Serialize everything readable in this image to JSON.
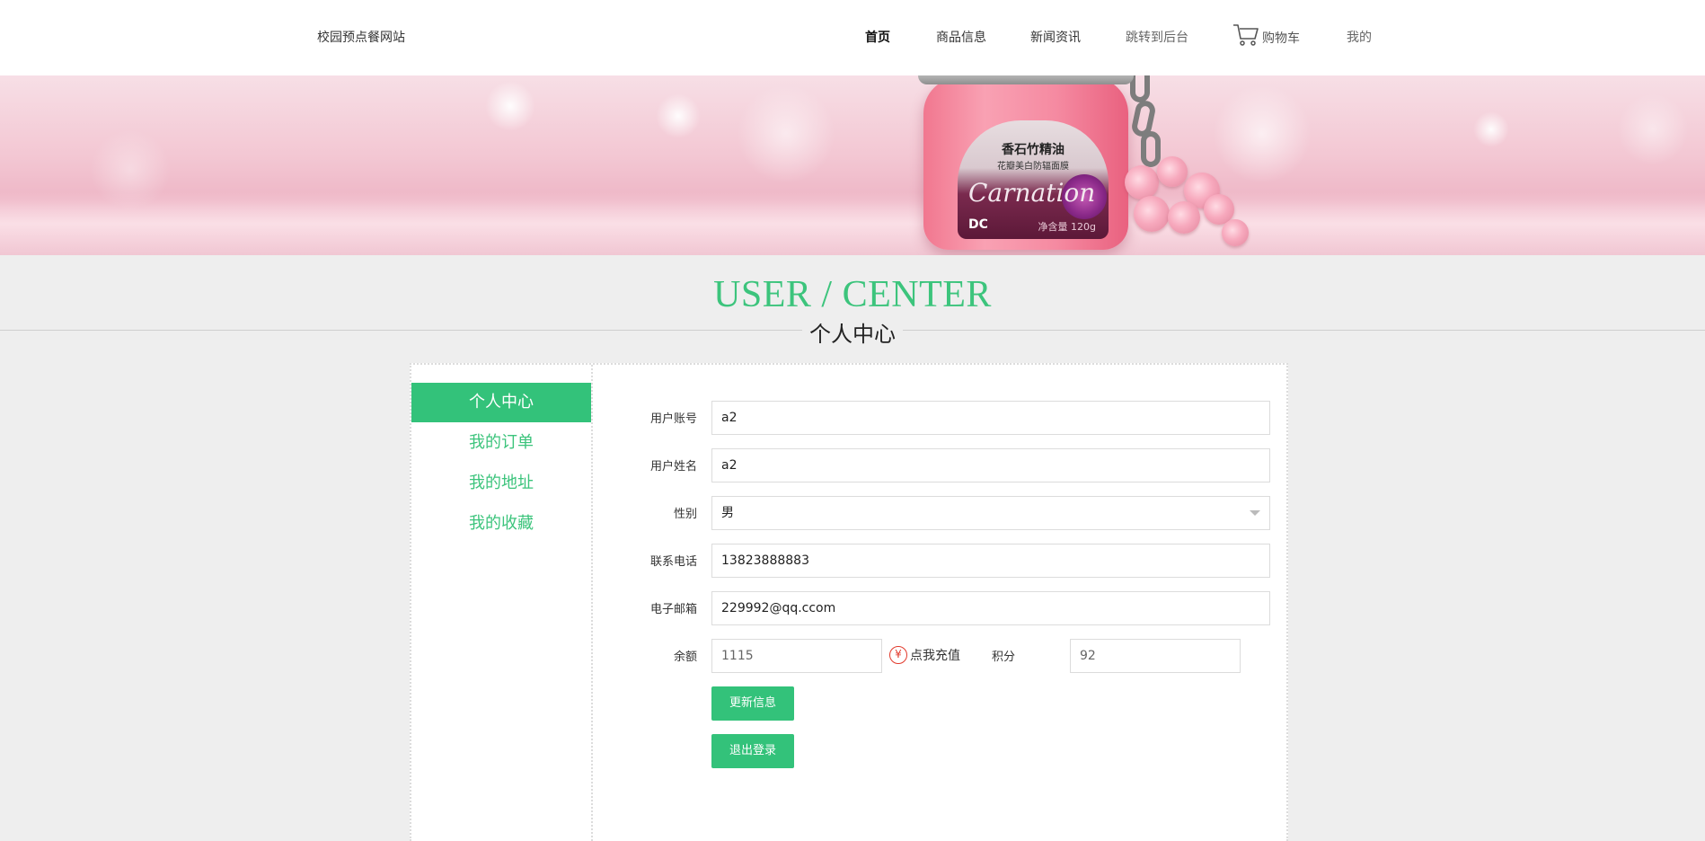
{
  "header": {
    "site_name": "校园预点餐网站",
    "nav": {
      "home": "首页",
      "products": "商品信息",
      "news": "新闻资讯",
      "backend": "跳转到后台",
      "cart": "购物车",
      "mine": "我的"
    }
  },
  "banner": {
    "product_name": "香石竹精油",
    "product_desc": "花瓣美白防辐面膜",
    "brand_script": "Carnation",
    "brand_mark": "DC",
    "weight": "净含量 120g"
  },
  "title": {
    "en": "USER / CENTER",
    "cn": "个人中心"
  },
  "sidebar": {
    "items": [
      {
        "label": "个人中心",
        "active": true
      },
      {
        "label": "我的订单",
        "active": false
      },
      {
        "label": "我的地址",
        "active": false
      },
      {
        "label": "我的收藏",
        "active": false
      }
    ]
  },
  "form": {
    "account_label": "用户账号",
    "account_value": "a2",
    "name_label": "用户姓名",
    "name_value": "a2",
    "gender_label": "性别",
    "gender_value": "男",
    "phone_label": "联系电话",
    "phone_value": "13823888883",
    "email_label": "电子邮箱",
    "email_value": "229992@qq.ccom",
    "balance_label": "余额",
    "balance_value": "1115",
    "recharge_label": "点我充值",
    "recharge_icon": "yen-icon",
    "points_label": "积分",
    "points_value": "92",
    "update_button": "更新信息",
    "logout_button": "退出登录"
  },
  "colors": {
    "accent": "#33c27a",
    "title_green": "#3cc47c",
    "recharge_red": "#e23a2c"
  }
}
